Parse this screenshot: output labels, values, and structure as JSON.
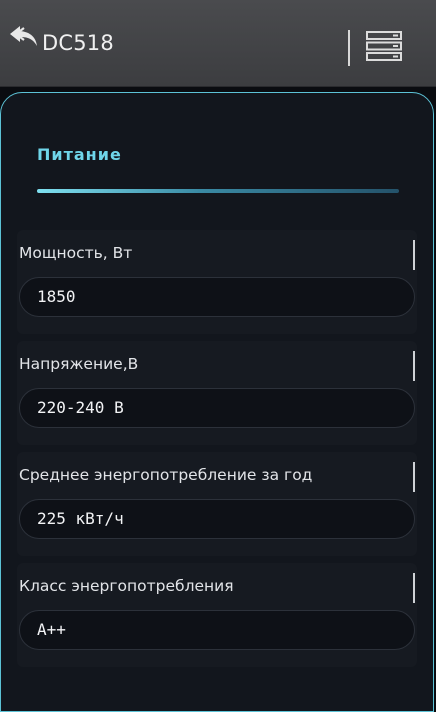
{
  "header": {
    "title": "DC518",
    "back_icon": "back-arrow-icon",
    "menu_icon": "server-list-icon"
  },
  "section": {
    "title": "Питание"
  },
  "fields": [
    {
      "label": "Мощность, Вт",
      "value": "1850"
    },
    {
      "label": "Напряжение,В",
      "value": "220-240 В"
    },
    {
      "label": "Среднее энергопотребление за год",
      "value": "225 кВт/ч"
    },
    {
      "label": "Класс энергопотребления",
      "value": "А++"
    }
  ],
  "colors": {
    "accent": "#6fd6ea",
    "header_bg": "#444548",
    "panel_bg": "#12161d"
  }
}
